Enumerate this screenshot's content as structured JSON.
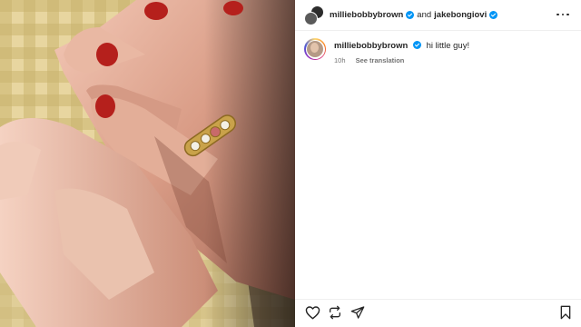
{
  "header": {
    "user1": "milliebobbybrown",
    "connector": "and",
    "user2": "jakebongiovi",
    "avatar_icon": "collab-avatars-icon",
    "menu_icon": "more-options-icon"
  },
  "comment": {
    "username": "milliebobbybrown",
    "text": "hi little guy!",
    "time": "10h",
    "see_translation": "See translation"
  },
  "actions": {
    "like_icon": "heart-icon",
    "repost_icon": "repost-icon",
    "share_icon": "send-icon",
    "save_icon": "bookmark-icon"
  },
  "colors": {
    "verified": "#0095f6",
    "text": "#262626",
    "secondary": "#737373",
    "divider": "#efefef"
  }
}
